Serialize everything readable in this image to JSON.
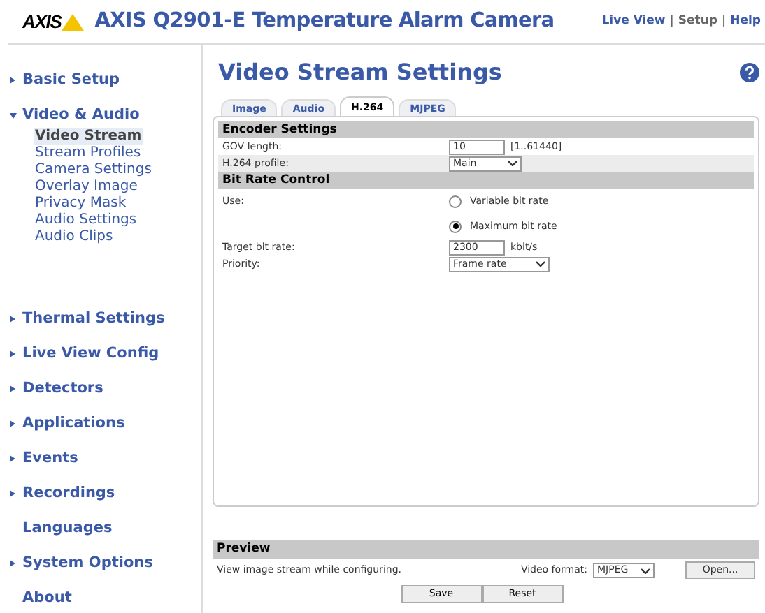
{
  "header": {
    "brand": "AXIS",
    "title": "AXIS Q2901-E Temperature Alarm Camera",
    "nav": [
      {
        "label": "Live View",
        "selected": false
      },
      {
        "label": "Setup",
        "selected": true
      },
      {
        "label": "Help",
        "selected": false
      }
    ],
    "separators": [
      "|",
      "|"
    ]
  },
  "sidebar": {
    "items": [
      {
        "label": "Basic Setup",
        "kind": "section",
        "expanded": false
      },
      {
        "label": "Video & Audio",
        "kind": "section",
        "expanded": true,
        "children": [
          {
            "label": "Video Stream",
            "selected": true
          },
          {
            "label": "Stream Profiles",
            "selected": false
          },
          {
            "label": "Camera Settings",
            "selected": false
          },
          {
            "label": "Overlay Image",
            "selected": false
          },
          {
            "label": "Privacy Mask",
            "selected": false
          },
          {
            "label": "Audio Settings",
            "selected": false
          },
          {
            "label": "Audio Clips",
            "selected": false
          }
        ]
      },
      {
        "label": "Thermal Settings",
        "kind": "section",
        "expanded": false
      },
      {
        "label": "Live View Config",
        "kind": "section",
        "expanded": false
      },
      {
        "label": "Detectors",
        "kind": "section",
        "expanded": false
      },
      {
        "label": "Applications",
        "kind": "section",
        "expanded": false
      },
      {
        "label": "Events",
        "kind": "section",
        "expanded": false
      },
      {
        "label": "Recordings",
        "kind": "section",
        "expanded": false
      },
      {
        "label": "Languages",
        "kind": "link"
      },
      {
        "label": "System Options",
        "kind": "section",
        "expanded": false
      },
      {
        "label": "About",
        "kind": "link"
      }
    ]
  },
  "page": {
    "title": "Video Stream Settings",
    "tabs": [
      {
        "label": "Image",
        "selected": false
      },
      {
        "label": "Audio",
        "selected": false
      },
      {
        "label": "H.264",
        "selected": true
      },
      {
        "label": "MJPEG",
        "selected": false
      }
    ],
    "rows": [
      {
        "kind": "heading",
        "label": "Encoder Settings"
      },
      {
        "kind": "input",
        "label": "GOV length:",
        "value": "10",
        "suffix": "[1..61440]"
      },
      {
        "kind": "select",
        "label": "H.264 profile:",
        "value": "Main"
      },
      {
        "kind": "heading",
        "label": "Bit Rate Control"
      },
      {
        "kind": "radio",
        "label": "Use:",
        "option": "Variable bit rate",
        "selected": false
      },
      {
        "kind": "radio",
        "option": "Maximum bit rate",
        "selected": true
      },
      {
        "kind": "input",
        "label": "Target bit rate:",
        "value": "2300",
        "suffix": "kbit/s"
      },
      {
        "kind": "select",
        "label": "Priority:",
        "value": "Frame rate"
      }
    ]
  },
  "preview": {
    "heading": "Preview",
    "text": "View image stream while configuring.",
    "format_label": "Video format:",
    "format": "MJPEG",
    "open_button": "Open..."
  },
  "buttons": [
    "Save",
    "Reset"
  ]
}
